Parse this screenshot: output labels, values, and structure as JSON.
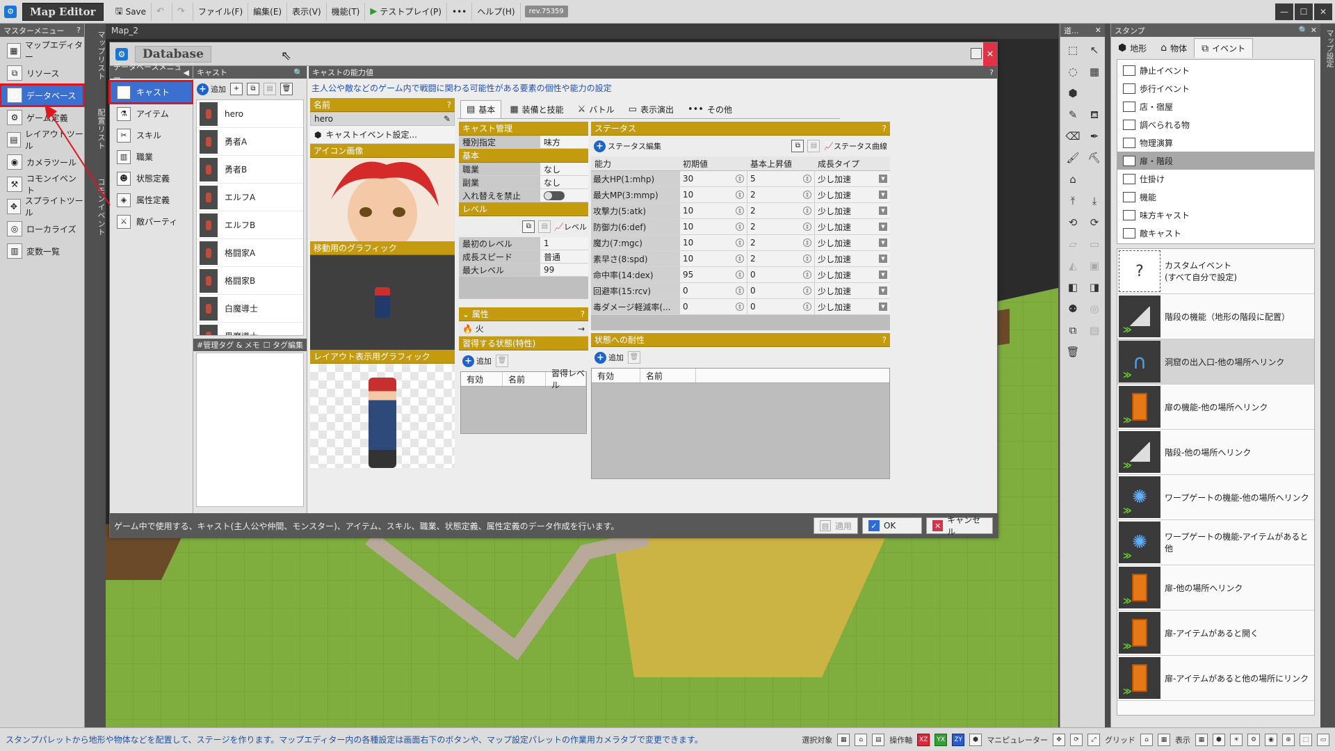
{
  "titlebar": {
    "brand": "Map Editor",
    "save": "Save",
    "menus": [
      "ファイル(F)",
      "編集(E)",
      "表示(V)",
      "機能(T)"
    ],
    "testplay": "テストプレイ(P)",
    "more": "•••",
    "help": "ヘルプ(H)",
    "revision": "rev.75359"
  },
  "leftmenu": {
    "title": "マスターメニュー",
    "items": [
      {
        "label": "マップエディター",
        "icon": "map-icon"
      },
      {
        "label": "リソース",
        "icon": "resource-icon"
      },
      {
        "label": "データベース",
        "icon": "database-icon",
        "selected": true
      },
      {
        "label": "ゲーム定義",
        "icon": "game-definition-icon"
      },
      {
        "label": "レイアウトツール",
        "icon": "layout-icon"
      },
      {
        "label": "カメラツール",
        "icon": "camera-icon"
      },
      {
        "label": "コモンイベント",
        "icon": "common-event-icon"
      },
      {
        "label": "スプライトツール",
        "icon": "sprite-icon"
      },
      {
        "label": "ローカライズ",
        "icon": "localize-icon"
      },
      {
        "label": "変数一覧",
        "icon": "variables-icon"
      }
    ],
    "strip1": "マップリスト",
    "strip2": "配置リスト",
    "strip3": "コモンイベント"
  },
  "map": {
    "tab": "Map_2"
  },
  "database": {
    "title": "Database",
    "nav_title": "データベースメニュー",
    "nav": [
      {
        "label": "キャスト",
        "selected": true
      },
      {
        "label": "アイテム"
      },
      {
        "label": "スキル"
      },
      {
        "label": "職業"
      },
      {
        "label": "状態定義"
      },
      {
        "label": "属性定義"
      },
      {
        "label": "敵パーティ"
      }
    ],
    "cast_list": {
      "title": "キャスト",
      "add": "追加",
      "items": [
        "hero",
        "勇者A",
        "勇者B",
        "エルフA",
        "エルフB",
        "格闘家A",
        "格闘家B",
        "白魔導士",
        "黒魔導士"
      ],
      "tag_title": "#管理タグ & メモ",
      "tag_edit": "タグ編集"
    },
    "ability": {
      "title": "キャストの能力値",
      "description": "主人公や敵などのゲーム内で戦闘に関わる可能性がある要素の個性や能力の設定",
      "name_label": "名前",
      "name_value": "hero",
      "cast_event": "キャストイベント設定...",
      "icon_image": "アイコン画像",
      "move_graphic": "移動用のグラフィック",
      "layout_graphic": "レイアウト表示用グラフィック"
    },
    "tabs": [
      "基本",
      "装備と技能",
      "バトル",
      "表示演出",
      "その他"
    ],
    "cast_mgmt": {
      "title": "キャスト管理",
      "kind_label": "種別指定",
      "kind_value": "味方",
      "basic": "基本",
      "job_label": "職業",
      "job_value": "なし",
      "subjob_label": "副業",
      "subjob_value": "なし",
      "lock_label": "入れ替えを禁止",
      "level_title": "レベル",
      "level_btn": "レベル",
      "first_level_label": "最初のレベル",
      "first_level_value": "1",
      "growth_label": "成長スピード",
      "growth_value": "普通",
      "max_level_label": "最大レベル",
      "max_level_value": "99"
    },
    "attribute": {
      "title": "属性",
      "value": "火"
    },
    "learned": {
      "title": "習得する状態(特性)",
      "add": "追加",
      "cols": [
        "有効",
        "名前",
        "習得レベル"
      ]
    },
    "status": {
      "title": "ステータス",
      "edit": "ステータス編集",
      "curve": "ステータス曲線",
      "cols": [
        "能力",
        "初期値",
        "基本上昇値",
        "成長タイプ"
      ],
      "rows": [
        {
          "name": "最大HP(1:mhp)",
          "init": "30",
          "up": "5",
          "type": "少し加速"
        },
        {
          "name": "最大MP(3:mmp)",
          "init": "10",
          "up": "2",
          "type": "少し加速"
        },
        {
          "name": "攻撃力(5:atk)",
          "init": "10",
          "up": "2",
          "type": "少し加速"
        },
        {
          "name": "防御力(6:def)",
          "init": "10",
          "up": "2",
          "type": "少し加速"
        },
        {
          "name": "魔力(7:mgc)",
          "init": "10",
          "up": "2",
          "type": "少し加速"
        },
        {
          "name": "素早さ(8:spd)",
          "init": "10",
          "up": "2",
          "type": "少し加速"
        },
        {
          "name": "命中率(14:dex)",
          "init": "95",
          "up": "0",
          "type": "少し加速"
        },
        {
          "name": "回避率(15:rcv)",
          "init": "0",
          "up": "0",
          "type": "少し加速"
        },
        {
          "name": "毒ダメージ軽減率(...",
          "init": "0",
          "up": "0",
          "type": "少し加速"
        }
      ]
    },
    "resist": {
      "title": "状態への耐性",
      "add": "追加",
      "cols": [
        "有効",
        "名前"
      ]
    },
    "footer": {
      "description": "ゲーム中で使用する、キャスト(主人公や仲間、モンスター)、アイテム、スキル、職業、状態定義、属性定義のデータ作成を行います。",
      "apply": "適用",
      "ok": "OK",
      "cancel": "キャンセル"
    }
  },
  "tools": {
    "title": "道..."
  },
  "stamp": {
    "title": "スタンプ",
    "tabs": [
      "地形",
      "物体",
      "イベント"
    ],
    "tree": [
      "静止イベント",
      "歩行イベント",
      "店・宿屋",
      "調べられる物",
      "物理演算",
      "扉・階段",
      "仕掛け",
      "機能",
      "味方キャスト",
      "敵キャスト"
    ],
    "tree_selected": "扉・階段",
    "events": [
      {
        "label": "カスタムイベント\n(すべて自分で設定)",
        "icon": "custom-event-icon"
      },
      {
        "label": "階段の機能（地形の階段に配置）",
        "icon": "stairs-icon"
      },
      {
        "label": "洞窟の出入口-他の場所へリンク",
        "icon": "cave-icon",
        "selected": true
      },
      {
        "label": "扉の機能-他の場所へリンク",
        "icon": "door-icon"
      },
      {
        "label": "階段-他の場所へリンク",
        "icon": "stairs-icon"
      },
      {
        "label": "ワープゲートの機能-他の場所へリンク",
        "icon": "warp-icon"
      },
      {
        "label": "ワープゲートの機能-アイテムがあると他",
        "icon": "warp-icon"
      },
      {
        "label": "扉-他の場所へリンク",
        "icon": "door-icon"
      },
      {
        "label": "扉-アイテムがあると開く",
        "icon": "door-icon"
      },
      {
        "label": "扉-アイテムがあると他の場所にリンク",
        "icon": "door-icon"
      }
    ],
    "strip": "マップ設定"
  },
  "statusbar": {
    "hint": "スタンプパレットから地形や物体などを配置して、ステージを作ります。マップエディター内の各種設定は画面右下のボタンや、マップ設定パレットの作業用カメラタブで変更できます。",
    "select": "選択対象",
    "operate": "操作軸",
    "manip": "マニピュレーター",
    "grid": "グリッド",
    "view": "表示"
  }
}
